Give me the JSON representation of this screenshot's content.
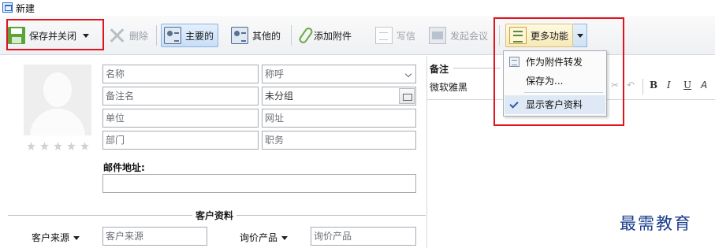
{
  "window": {
    "title": "新建"
  },
  "toolbar": {
    "save_close": "保存并关闭",
    "delete": "删除",
    "primary": "主要的",
    "others": "其他的",
    "attach": "添加附件",
    "write": "写信",
    "meeting": "发起会议",
    "more": "更多功能"
  },
  "more_menu": {
    "items": [
      {
        "label": "作为附件转发",
        "icon": "forward-attachment-icon"
      },
      {
        "label": "保存为...",
        "icon": ""
      },
      {
        "label": "显示客户资料",
        "icon": "check-icon",
        "checked": true
      }
    ]
  },
  "contact": {
    "name_placeholder": "名称",
    "title_placeholder": "称呼",
    "note_name_placeholder": "备注名",
    "group_value": "未分组",
    "company_placeholder": "单位",
    "website_placeholder": "网址",
    "department_placeholder": "部门",
    "position_placeholder": "职务",
    "email_label": "邮件地址:",
    "email_value": ""
  },
  "customer_section": {
    "title": "客户资料",
    "source_label": "客户来源",
    "source_placeholder": "客户来源",
    "product_label": "询价产品",
    "product_placeholder": "询价产品"
  },
  "notes": {
    "title": "备注",
    "font": "微软雅黑",
    "format_bold": "B",
    "format_italic": "I",
    "format_underline": "U"
  },
  "watermark": "最需教育",
  "colors": {
    "highlight": "#e0141e",
    "accent": "#2b6cc4"
  }
}
